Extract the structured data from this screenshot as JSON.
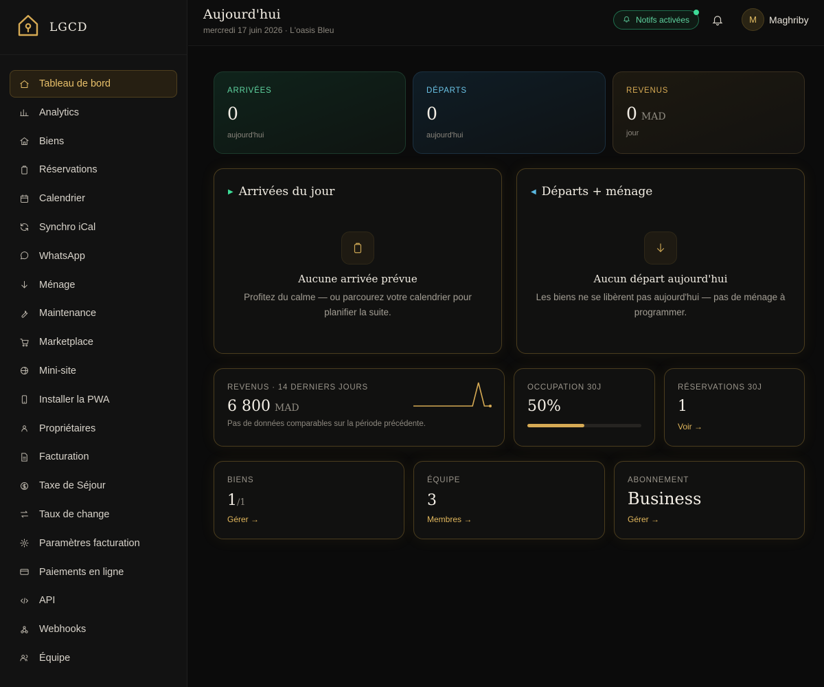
{
  "brand": {
    "name": "LGCD"
  },
  "sidebar": {
    "items": [
      {
        "label": "Tableau de bord",
        "icon": "home-icon",
        "active": true
      },
      {
        "label": "Analytics",
        "icon": "bar-chart-icon"
      },
      {
        "label": "Biens",
        "icon": "house-icon"
      },
      {
        "label": "Réservations",
        "icon": "clipboard-icon"
      },
      {
        "label": "Calendrier",
        "icon": "calendar-icon"
      },
      {
        "label": "Synchro iCal",
        "icon": "sync-icon"
      },
      {
        "label": "WhatsApp",
        "icon": "chat-icon"
      },
      {
        "label": "Ménage",
        "icon": "arrow-down-icon"
      },
      {
        "label": "Maintenance",
        "icon": "wrench-icon"
      },
      {
        "label": "Marketplace",
        "icon": "cart-icon"
      },
      {
        "label": "Mini-site",
        "icon": "globe-icon"
      },
      {
        "label": "Installer la PWA",
        "icon": "phone-icon"
      },
      {
        "label": "Propriétaires",
        "icon": "person-icon"
      },
      {
        "label": "Facturation",
        "icon": "document-icon"
      },
      {
        "label": "Taxe de Séjour",
        "icon": "coin-icon"
      },
      {
        "label": "Taux de change",
        "icon": "swap-icon"
      },
      {
        "label": "Paramètres facturation",
        "icon": "gear-icon"
      },
      {
        "label": "Paiements en ligne",
        "icon": "credit-card-icon"
      },
      {
        "label": "API",
        "icon": "code-icon"
      },
      {
        "label": "Webhooks",
        "icon": "webhook-icon"
      },
      {
        "label": "Équipe",
        "icon": "team-icon"
      }
    ]
  },
  "header": {
    "title": "Aujourd'hui",
    "subtitle": "mercredi 17 juin 2026 · L'oasis Bleu",
    "notif_label": "Notifs activées",
    "user_initial": "M",
    "user_name": "Maghriby"
  },
  "stats": {
    "arrivals": {
      "label": "Arrivées",
      "value": "0",
      "sub": "aujourd'hui"
    },
    "departures": {
      "label": "Départs",
      "value": "0",
      "sub": "aujourd'hui"
    },
    "revenue": {
      "label": "Revenus",
      "value": "0",
      "unit": "MAD",
      "sub": "jour"
    }
  },
  "panels": {
    "arrivals": {
      "title": "Arrivées du jour",
      "empty_title": "Aucune arrivée prévue",
      "empty_text": "Profitez du calme — ou parcourez votre calendrier pour planifier la suite."
    },
    "departures": {
      "title": "Départs + ménage",
      "empty_title": "Aucun départ aujourd'hui",
      "empty_text": "Les biens ne se libèrent pas aujourd'hui — pas de ménage à programmer."
    }
  },
  "metrics": {
    "revenue14": {
      "label": "Revenus · 14 derniers jours",
      "value": "6 800",
      "unit": "MAD",
      "note": "Pas de données comparables sur la période précédente.",
      "sparkline": [
        0,
        0,
        0,
        0,
        0,
        0,
        0,
        0,
        0,
        0,
        0,
        6800,
        0,
        0
      ]
    },
    "occupancy": {
      "label": "Occupation 30j",
      "value": "50%",
      "fraction": 0.5
    },
    "reservations": {
      "label": "Réservations 30j",
      "value": "1",
      "link": "Voir →"
    }
  },
  "summary": {
    "biens": {
      "label": "Biens",
      "value": "1",
      "total": "/1",
      "link": "Gérer →"
    },
    "equipe": {
      "label": "Équipe",
      "value": "3",
      "link": "Membres →"
    },
    "abonnement": {
      "label": "Abonnement",
      "value": "Business",
      "link": "Gérer →"
    }
  },
  "colors": {
    "accent": "#e8c06a",
    "green": "#3ddc97",
    "blue": "#5ab8e0"
  }
}
